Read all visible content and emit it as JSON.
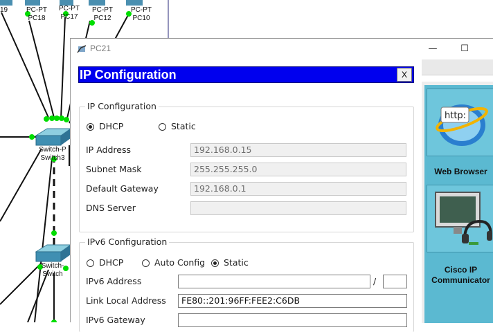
{
  "topology": {
    "nodes": [
      {
        "label": "19",
        "sub": ""
      },
      {
        "label": "PC-PT",
        "sub": "PC18"
      },
      {
        "label": "PC-PT",
        "sub": "PC17"
      },
      {
        "label": "PC-PT",
        "sub": "PC12"
      },
      {
        "label": "PC-PT",
        "sub": "PC10"
      }
    ],
    "switch3": {
      "model": "Switch-P",
      "name": "Switch3"
    },
    "switch_lower": {
      "model": "Switch-",
      "name": "Switch"
    }
  },
  "window": {
    "title": "PC21",
    "minimize_glyph": "—",
    "maximize_glyph": "☐"
  },
  "desktop": {
    "apps": [
      {
        "icon_name": "web-browser-icon",
        "icon_text": "http:",
        "label": "Web Browser"
      },
      {
        "icon_name": "cisco-ip-communicator-icon",
        "label_line1": "Cisco IP",
        "label_line2": "Communicator"
      }
    ]
  },
  "ip_config": {
    "header_title": "IP Configuration",
    "close_label": "X",
    "ipv4": {
      "group_title": "IP Configuration",
      "dhcp_label": "DHCP",
      "static_label": "Static",
      "selected_mode": "DHCP",
      "ip_address_label": "IP Address",
      "ip_address_value": "192.168.0.15",
      "subnet_mask_label": "Subnet Mask",
      "subnet_mask_value": "255.255.255.0",
      "default_gateway_label": "Default Gateway",
      "default_gateway_value": "192.168.0.1",
      "dns_server_label": "DNS Server",
      "dns_server_value": ""
    },
    "ipv6": {
      "group_title": "IPv6 Configuration",
      "dhcp_label": "DHCP",
      "auto_config_label": "Auto Config",
      "static_label": "Static",
      "selected_mode": "Static",
      "ipv6_address_label": "IPv6 Address",
      "ipv6_address_value": "",
      "prefix_separator": "/",
      "prefix_value": "",
      "link_local_label": "Link Local Address",
      "link_local_value": "FE80::201:96FF:FEE2:C6DB",
      "ipv6_gateway_label": "IPv6 Gateway",
      "ipv6_gateway_value": ""
    }
  },
  "colors": {
    "header_blue": "#0000ee",
    "link_green": "#00dd00",
    "desktop_teal": "#5bb9d1"
  }
}
